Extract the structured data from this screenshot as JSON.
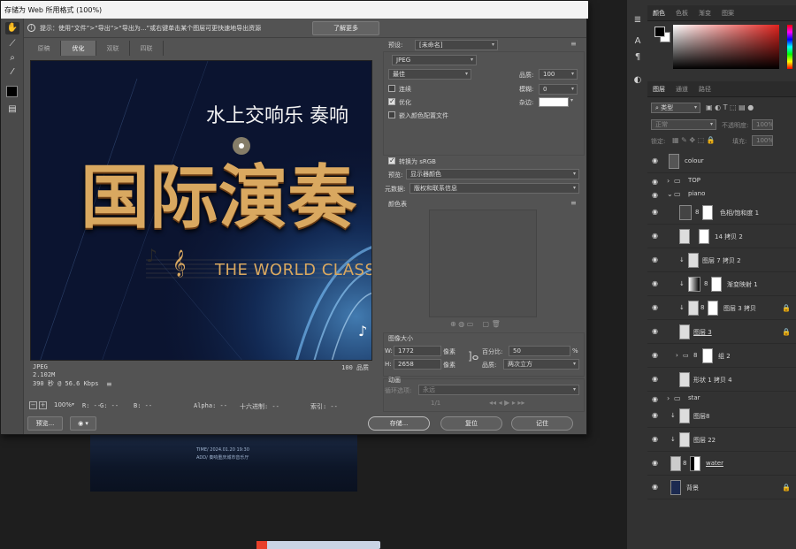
{
  "dialog": {
    "title": "存储为 Web 所用格式 (100%)",
    "hint": "提示：使用“文件”>“导出”>“导出为...”或右键单击某个图层可更快速地导出资源",
    "learn_more": "了解更多",
    "tabs": [
      "原稿",
      "优化",
      "双联",
      "四联"
    ],
    "active_tab": "优化"
  },
  "preview": {
    "subtitle": "水上交响乐 奏响",
    "headline": "国际演奏",
    "english": "THE WORLD CLASS",
    "info_left": [
      "JPEG",
      "2.102M",
      "390 秒 @ 56.6 Kbps"
    ],
    "info_right": "100 品质",
    "info_menu": "≡"
  },
  "statusbar": {
    "zoom": "100%",
    "r": "R: --",
    "g": "G: --",
    "b": "B: --",
    "alpha": "Alpha: --",
    "hex": "十六进制: --",
    "index": "索引: --"
  },
  "buttons": {
    "preview": "预览...",
    "save": "存储...",
    "reset": "复位",
    "remember": "记住"
  },
  "settings": {
    "preset_label": "预设:",
    "preset_value": "[未命名]",
    "format": "JPEG",
    "quality_mode": "最佳",
    "quality_label": "品质:",
    "quality_value": "100",
    "progressive_label": "连续",
    "blur_label": "模糊:",
    "blur_value": "0",
    "optimized_label": "优化",
    "matte_label": "杂边:",
    "embed_profile_label": "嵌入颜色配置文件",
    "convert_srgb_label": "转换为 sRGB",
    "preview_label": "预览:",
    "preview_value": "显示器颜色",
    "metadata_label": "元数据:",
    "metadata_value": "版权和联系信息",
    "color_table_title": "颜色表",
    "image_size_title": "图像大小",
    "w_label": "W:",
    "w_value": "1772",
    "h_label": "H:",
    "h_value": "2658",
    "px_unit": "像素",
    "percent_label": "百分比:",
    "percent_value": "50",
    "percent_unit": "%",
    "quality2_label": "品质:",
    "quality2_value": "两次立方",
    "animation_title": "动画",
    "loop_label": "循环选项:",
    "loop_value": "永远",
    "frame_counter": "1/1"
  },
  "right_panel": {
    "top_tabs": [
      "颜色",
      "色板",
      "渐变",
      "图案"
    ],
    "layer_tabs": [
      "图层",
      "通道",
      "路径"
    ],
    "kind_label": "类型",
    "blend_mode": "正常",
    "opacity_label": "不透明度:",
    "opacity_value": "100%",
    "lock_label": "锁定:",
    "fill_label": "填充:",
    "fill_value": "100%",
    "layers": [
      {
        "name": "colour",
        "kind": "layer"
      },
      {
        "name": "TOP",
        "kind": "group"
      },
      {
        "name": "piano",
        "kind": "group-open"
      },
      {
        "name": "色相/饱和度 1",
        "kind": "adjust"
      },
      {
        "name": "14 拷贝 2",
        "kind": "layer"
      },
      {
        "name": "图层 7 拷贝 2",
        "kind": "layer"
      },
      {
        "name": "渐变映射 1",
        "kind": "adjust"
      },
      {
        "name": "图层 3 拷贝",
        "kind": "layer",
        "locked": true
      },
      {
        "name": "图层 3",
        "kind": "layer",
        "locked": true
      },
      {
        "name": "组 2",
        "kind": "group"
      },
      {
        "name": "形状 1 拷贝 4",
        "kind": "layer"
      },
      {
        "name": "star",
        "kind": "group"
      },
      {
        "name": "图层8",
        "kind": "layer"
      },
      {
        "name": "图层 22",
        "kind": "layer"
      },
      {
        "name": "water",
        "kind": "layer"
      },
      {
        "name": "背景",
        "kind": "layer",
        "locked": true
      }
    ]
  },
  "background_doc": {
    "line1": "TIME/  2024.01.20 19:30",
    "line2": "ADD/  奏响重庆城市音乐厅"
  },
  "colors": {
    "accent": "#e0231e",
    "gold": "#d9a860",
    "navy": "#0b1430"
  }
}
